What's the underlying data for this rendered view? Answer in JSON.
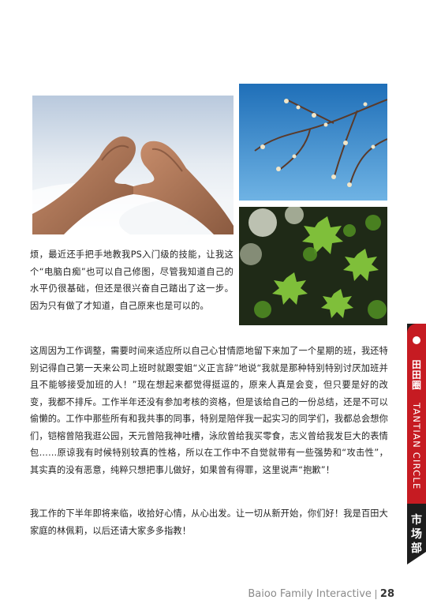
{
  "article": {
    "paragraphs": [
      "烦，最近还手把手地教我PS入门级的技能，让我这个“电脑白痴”也可以自己修图，尽管我知道自己的水平仍很基础，但还是很兴奋自己踏出了这一步。因为只有做了才知道，自己原来也是可以的。",
      "这周因为工作调整，需要时间来适应所以自己心甘情愿地留下来加了一个星期的班，我还特别记得自己第一天来公司上班时就跟雯姐“义正言辞”地说“我就是那种特别特别讨厌加班并且不能够接受加班的人！”现在想起来都觉得挺逗的，原来人真是会变，但只要是好的改变，我都不排斥。工作半年还没有参加考核的资格，但是该给自己的一份总结，还是不可以偷懒的。工作中那些所有和我共事的同事，特别是陪伴我一起实习的同学们，我都总会想你们，铠榕曾陪我逛公园，天元曾陪我神吐槽，泳欣曾给我买零食，志义曾给我发巨大的表情包……原谅我有时候特别较真的性格，所以在工作中不自觉就带有一些强势和“攻击性”，其实真的没有恶意，纯粹只想把事儿做好，如果曾有得罪，这里说声“抱歉”！",
      "我工作的下半年即将来临，收拾好心情，从心出发。让一切从新开始，你们好！我是百田大家庭的林佩莉，以后还请大家多多指教！"
    ]
  },
  "side_tab": {
    "brand": "田田圈",
    "english": "TANTIAN CIRCLE",
    "department": "市场部"
  },
  "footer": {
    "company": "Baioo Family Interactive",
    "page": "28"
  },
  "colors": {
    "accent_red": "#c61b22",
    "tab_dark": "#1d1d1d"
  }
}
